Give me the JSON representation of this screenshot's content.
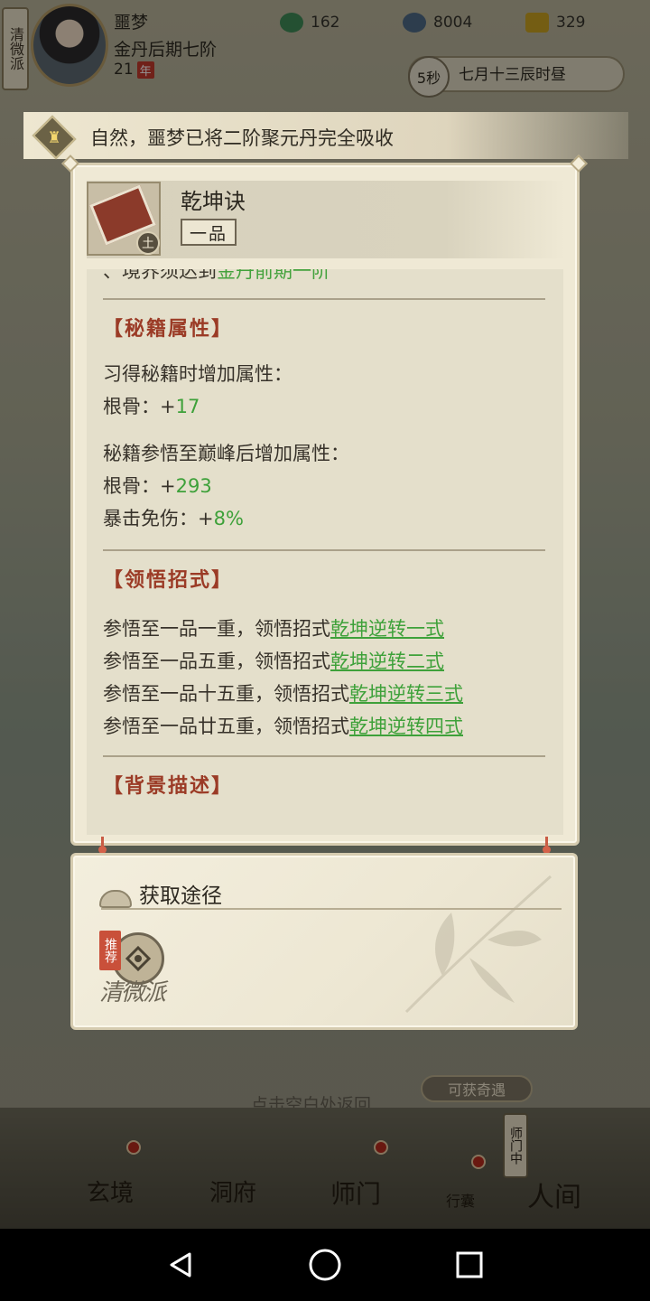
{
  "status": {
    "sect_banner": "清微派",
    "player_name": "噩梦",
    "realm": "金丹后期七阶",
    "age": "21",
    "age_unit": "年",
    "resources": [
      {
        "icon": "spirit-orb-icon",
        "value": "162"
      },
      {
        "icon": "spirit-stone-icon",
        "value": "8004"
      },
      {
        "icon": "gold-ingot-icon",
        "value": "329"
      }
    ],
    "timer": "5秒",
    "game_time": "七月十三辰时昼"
  },
  "notice": {
    "text": "自然，噩梦已将二阶聚元丹完全吸收"
  },
  "item": {
    "name": "乾坤诀",
    "grade": "一品",
    "element": "土",
    "requirement_prefix": "、境界须达到",
    "requirement_value": "金丹前期一阶",
    "attr_title": "【秘籍属性】",
    "learn_label": "习得秘籍时增加属性：",
    "learn_attr_name": "根骨：+",
    "learn_attr_value": "17",
    "peak_label": "秘籍参悟至巅峰后增加属性：",
    "peak_attr1_name": "根骨：+",
    "peak_attr1_value": "293",
    "peak_attr2_name": "暴击免伤：+",
    "peak_attr2_value": "8%",
    "tech_title": "【领悟招式】",
    "techniques": [
      {
        "prefix": "参悟至一品一重，领悟招式",
        "link": "乾坤逆转一式"
      },
      {
        "prefix": "参悟至一品五重，领悟招式",
        "link": "乾坤逆转二式"
      },
      {
        "prefix": "参悟至一品十五重，领悟招式",
        "link": "乾坤逆转三式"
      },
      {
        "prefix": "参悟至一品廿五重，领悟招式",
        "link": "乾坤逆转四式"
      }
    ],
    "bg_title": "【背景描述】"
  },
  "acquire": {
    "title": "获取途径",
    "recommend_tag": "推荐",
    "source_name": "清微派"
  },
  "background": {
    "encounter_button": "可获奇遇",
    "hint": "点击空白处返回",
    "shimen_status": "师门中",
    "nav": [
      {
        "label": "玄境"
      },
      {
        "label": "洞府"
      },
      {
        "label": "师门"
      },
      {
        "label": "行囊"
      },
      {
        "label": "人间"
      }
    ]
  },
  "colors": {
    "accent_green": "#3ea13a",
    "section_red": "#9b3b26",
    "panel_bg": "#efe9d5"
  }
}
